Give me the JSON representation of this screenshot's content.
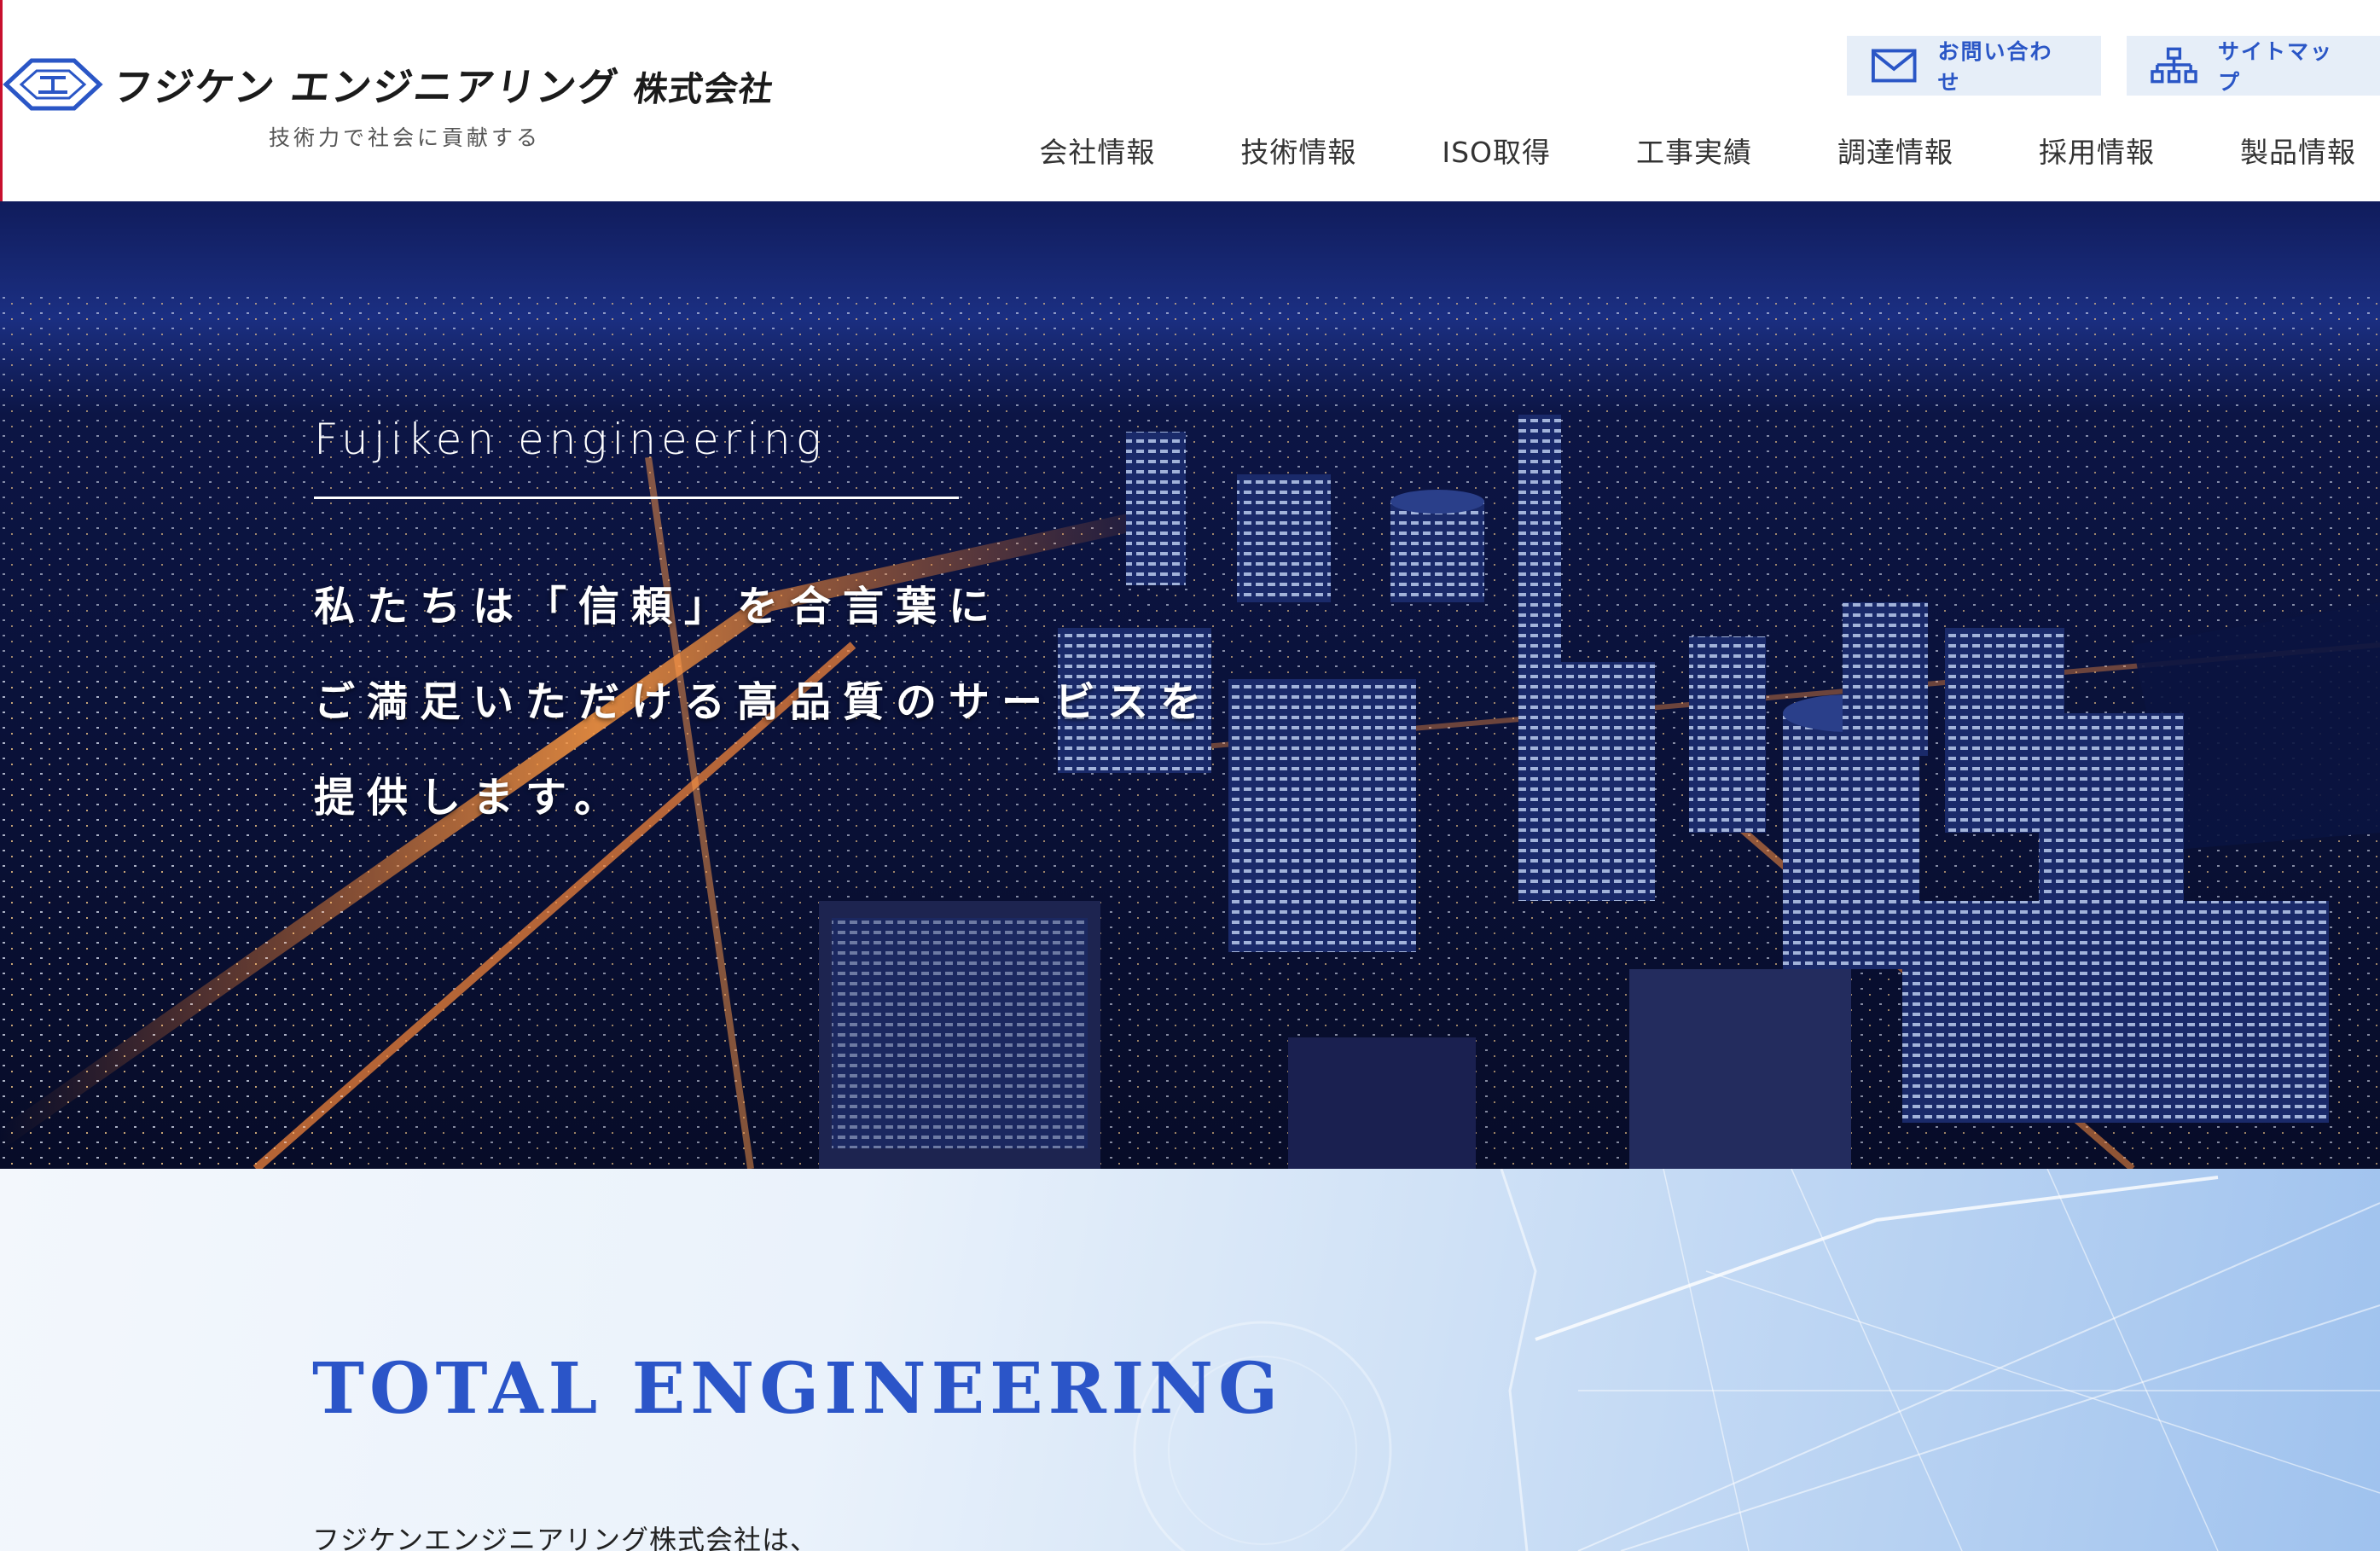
{
  "brand": {
    "company_name": "フジケン エンジニアリング",
    "company_suffix": "株式会社",
    "tagline": "技術力で社会に貢献する",
    "logo_icon": "fujiken-emblem-icon",
    "accent_color": "#2a56c6"
  },
  "utility_links": [
    {
      "label": "お問い合わせ",
      "icon": "mail-icon"
    },
    {
      "label": "サイトマップ",
      "icon": "sitemap-icon"
    }
  ],
  "nav": {
    "items": [
      {
        "label": "会社情報"
      },
      {
        "label": "技術情報"
      },
      {
        "label": "ISO取得"
      },
      {
        "label": "工事実績"
      },
      {
        "label": "調達情報"
      },
      {
        "label": "採用情報"
      },
      {
        "label": "製品情報"
      }
    ]
  },
  "hero": {
    "eyebrow": "Fujiken engineering",
    "lines": [
      "私たちは「信頼」を合言葉に",
      "ご満足いただける高品質のサービスを",
      "提供します。"
    ],
    "background": "night city skyline aerial photo"
  },
  "section": {
    "title": "TOTAL ENGINEERING",
    "intro": "フジケンエンジニアリング株式会社は、"
  }
}
